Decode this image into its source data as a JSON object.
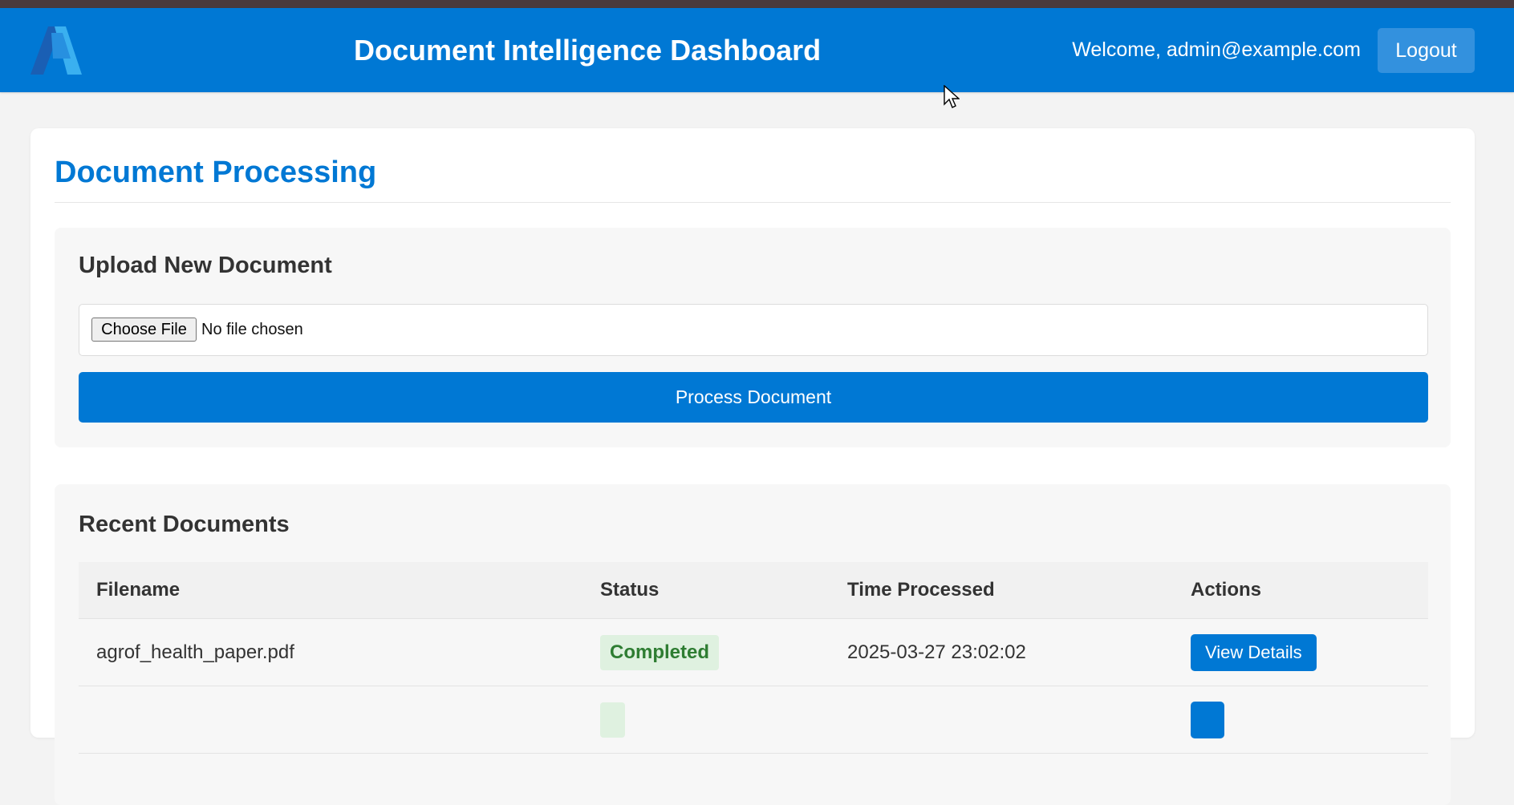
{
  "header": {
    "title": "Document Intelligence Dashboard",
    "welcome_text": "Welcome, admin@example.com",
    "logout_label": "Logout",
    "logo_icon": "azure-logo-icon"
  },
  "colors": {
    "brand": "#0078d4",
    "logout_bg": "#3391de",
    "status_completed_bg": "#dff1e0",
    "status_completed_text": "#2e7d32"
  },
  "main": {
    "page_title": "Document Processing",
    "upload": {
      "title": "Upload New Document",
      "choose_file_label": "Choose File",
      "file_status": "No file chosen",
      "process_label": "Process Document"
    },
    "recent": {
      "title": "Recent Documents",
      "columns": [
        "Filename",
        "Status",
        "Time Processed",
        "Actions"
      ],
      "rows": [
        {
          "filename": "agrof_health_paper.pdf",
          "status": "Completed",
          "time": "2025-03-27 23:02:02",
          "action": "View Details"
        },
        {
          "filename": "",
          "status": "",
          "time": "",
          "action": ""
        }
      ]
    }
  }
}
